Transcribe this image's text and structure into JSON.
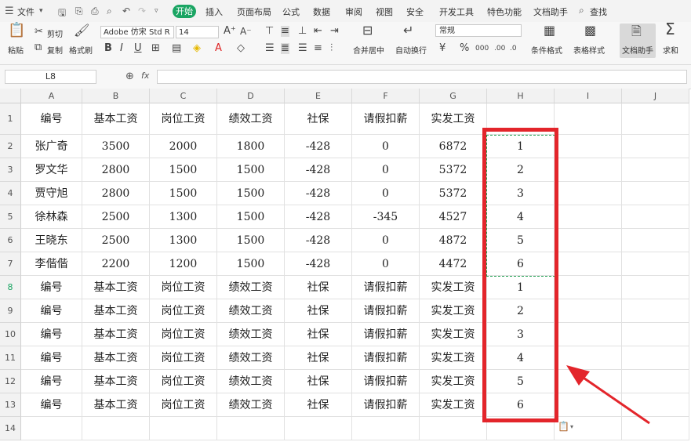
{
  "menubar": {
    "file_label": "文件",
    "start_label": "开始",
    "tabs": [
      "插入",
      "页面布局",
      "公式",
      "数据",
      "审阅",
      "视图",
      "安全",
      "开发工具",
      "特色功能",
      "文档助手"
    ],
    "search_label": "查找"
  },
  "ribbon": {
    "paste_label": "粘贴",
    "cut_label": "剪切",
    "copy_label": "复制",
    "format_painter_label": "格式刷",
    "font_name": "Adobe 仿宋 Std R",
    "font_size": "14",
    "number_format": "常规",
    "merge_center_label": "合并居中",
    "wrap_text_label": "自动换行",
    "conditional_format_label": "条件格式",
    "table_style_label": "表格样式",
    "doc_assistant_label": "文档助手",
    "sum_label": "求和"
  },
  "formula_bar": {
    "cell_ref": "L8",
    "fx_label": "fx",
    "value": ""
  },
  "grid": {
    "columns": [
      "A",
      "B",
      "C",
      "D",
      "E",
      "F",
      "G",
      "H",
      "I",
      "J"
    ],
    "row_numbers": [
      "1",
      "2",
      "3",
      "4",
      "5",
      "6",
      "7",
      "8",
      "9",
      "10",
      "11",
      "12",
      "13",
      "14"
    ],
    "active_row": "8",
    "rows": [
      [
        "编号",
        "基本工资",
        "岗位工资",
        "绩效工资",
        "社保",
        "请假扣薪",
        "实发工资",
        "",
        "",
        ""
      ],
      [
        "张广奇",
        "3500",
        "2000",
        "1800",
        "-428",
        "0",
        "6872",
        "1",
        "",
        ""
      ],
      [
        "罗文华",
        "2800",
        "1500",
        "1500",
        "-428",
        "0",
        "5372",
        "2",
        "",
        ""
      ],
      [
        "贾守旭",
        "2800",
        "1500",
        "1500",
        "-428",
        "0",
        "5372",
        "3",
        "",
        ""
      ],
      [
        "徐林森",
        "2500",
        "1300",
        "1500",
        "-428",
        "-345",
        "4527",
        "4",
        "",
        ""
      ],
      [
        "王晓东",
        "2500",
        "1300",
        "1500",
        "-428",
        "0",
        "4872",
        "5",
        "",
        ""
      ],
      [
        "李偕偕",
        "2200",
        "1200",
        "1500",
        "-428",
        "0",
        "4472",
        "6",
        "",
        ""
      ],
      [
        "编号",
        "基本工资",
        "岗位工资",
        "绩效工资",
        "社保",
        "请假扣薪",
        "实发工资",
        "1",
        "",
        ""
      ],
      [
        "编号",
        "基本工资",
        "岗位工资",
        "绩效工资",
        "社保",
        "请假扣薪",
        "实发工资",
        "2",
        "",
        ""
      ],
      [
        "编号",
        "基本工资",
        "岗位工资",
        "绩效工资",
        "社保",
        "请假扣薪",
        "实发工资",
        "3",
        "",
        ""
      ],
      [
        "编号",
        "基本工资",
        "岗位工资",
        "绩效工资",
        "社保",
        "请假扣薪",
        "实发工资",
        "4",
        "",
        ""
      ],
      [
        "编号",
        "基本工资",
        "岗位工资",
        "绩效工资",
        "社保",
        "请假扣薪",
        "实发工资",
        "5",
        "",
        ""
      ],
      [
        "编号",
        "基本工资",
        "岗位工资",
        "绩效工资",
        "社保",
        "请假扣薪",
        "实发工资",
        "6",
        "",
        ""
      ],
      [
        "",
        "",
        "",
        "",
        "",
        "",
        "",
        "",
        "",
        ""
      ]
    ]
  },
  "annotations": {
    "highlight_color": "#e3252b",
    "copy_marquee_color": "#1d9e4f",
    "accent_color": "#1aa563"
  }
}
